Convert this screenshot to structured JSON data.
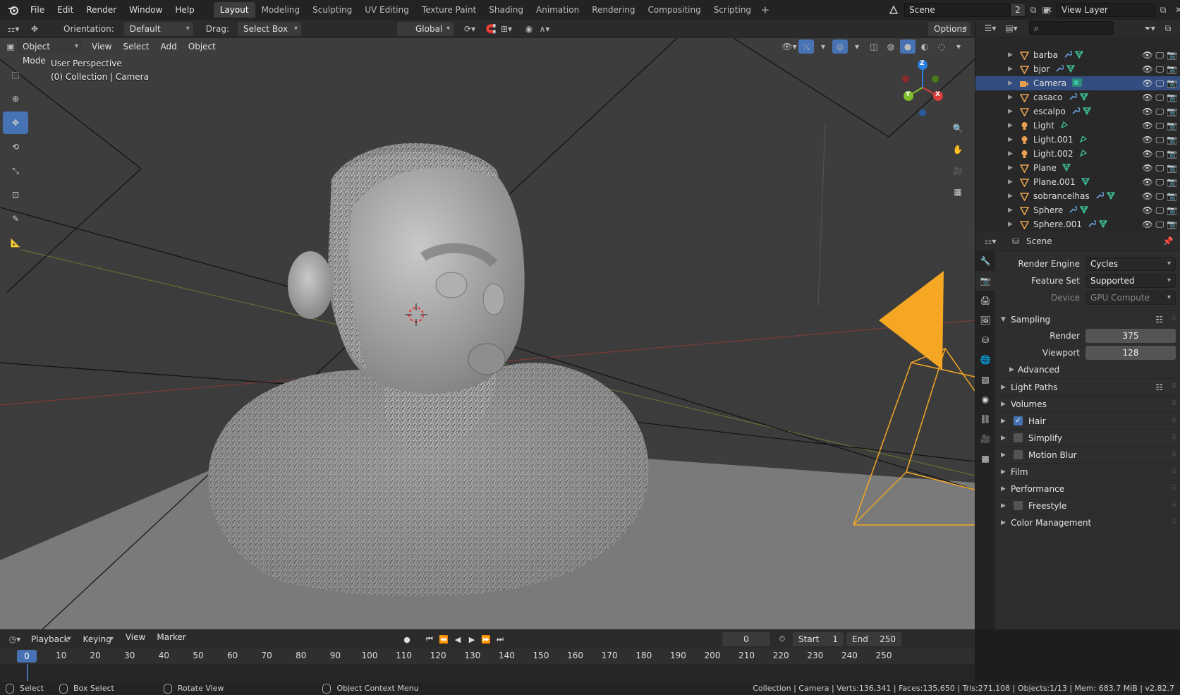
{
  "topbar": {
    "menus": [
      "File",
      "Edit",
      "Render",
      "Window",
      "Help"
    ],
    "workspaces": [
      "Layout",
      "Modeling",
      "Sculpting",
      "UV Editing",
      "Texture Paint",
      "Shading",
      "Animation",
      "Rendering",
      "Compositing",
      "Scripting"
    ],
    "active_workspace": "Layout",
    "scene_name": "Scene",
    "scene_users": "2",
    "view_layer": "View Layer"
  },
  "viewport_header": {
    "orientation_label": "Orientation:",
    "orientation_value": "Default",
    "drag_label": "Drag:",
    "drag_value": "Select Box",
    "transform_orientation": "Global",
    "options_label": "Options"
  },
  "viewport_menu": {
    "mode": "Object Mode",
    "items": [
      "View",
      "Select",
      "Add",
      "Object"
    ]
  },
  "viewport_overlay": {
    "perspective": "User Perspective",
    "collection": "(0) Collection | Camera"
  },
  "gizmo": {
    "x": "X",
    "y": "Y",
    "z": "Z"
  },
  "outliner": {
    "rows": [
      {
        "name": "barba",
        "icon": "mesh-icon",
        "mods": [
          "wrench-icon",
          "mesh-data-icon"
        ],
        "selected": false
      },
      {
        "name": "bjor",
        "icon": "mesh-icon",
        "mods": [
          "wrench-icon",
          "mesh-data-icon"
        ],
        "selected": false
      },
      {
        "name": "Camera",
        "icon": "camera-icon",
        "mods": [
          "camera-data-icon"
        ],
        "selected": true
      },
      {
        "name": "casaco",
        "icon": "mesh-icon",
        "mods": [
          "wrench-icon",
          "mesh-data-icon"
        ],
        "selected": false
      },
      {
        "name": "escalpo",
        "icon": "mesh-icon",
        "mods": [
          "wrench-icon",
          "mesh-data-icon"
        ],
        "selected": false
      },
      {
        "name": "Light",
        "icon": "light-icon",
        "mods": [
          "light-data-icon"
        ],
        "selected": false
      },
      {
        "name": "Light.001",
        "icon": "light-icon",
        "mods": [
          "light-data-icon"
        ],
        "selected": false
      },
      {
        "name": "Light.002",
        "icon": "light-icon",
        "mods": [
          "light-data-icon"
        ],
        "selected": false
      },
      {
        "name": "Plane",
        "icon": "mesh-icon",
        "mods": [
          "mesh-data-icon"
        ],
        "selected": false
      },
      {
        "name": "Plane.001",
        "icon": "mesh-icon",
        "mods": [
          "mesh-data-icon"
        ],
        "selected": false
      },
      {
        "name": "sobrancelhas",
        "icon": "mesh-icon",
        "mods": [
          "wrench-icon",
          "mesh-data-icon"
        ],
        "selected": false
      },
      {
        "name": "Sphere",
        "icon": "mesh-icon",
        "mods": [
          "wrench-icon",
          "mesh-data-icon"
        ],
        "selected": false
      },
      {
        "name": "Sphere.001",
        "icon": "mesh-icon",
        "mods": [
          "wrench-icon",
          "mesh-data-icon"
        ],
        "selected": false
      }
    ]
  },
  "properties": {
    "context": "Scene",
    "render_engine_label": "Render Engine",
    "render_engine": "Cycles",
    "feature_set_label": "Feature Set",
    "feature_set": "Supported",
    "device_label": "Device",
    "device": "GPU Compute",
    "sampling": {
      "title": "Sampling",
      "render_label": "Render",
      "render": "375",
      "viewport_label": "Viewport",
      "viewport": "128",
      "advanced": "Advanced"
    },
    "panels": [
      {
        "label": "Light Paths",
        "checkbox": null,
        "list": true
      },
      {
        "label": "Volumes",
        "checkbox": null,
        "list": false
      },
      {
        "label": "Hair",
        "checkbox": true,
        "list": false
      },
      {
        "label": "Simplify",
        "checkbox": false,
        "list": false
      },
      {
        "label": "Motion Blur",
        "checkbox": false,
        "list": false
      },
      {
        "label": "Film",
        "checkbox": null,
        "list": false
      },
      {
        "label": "Performance",
        "checkbox": null,
        "list": false
      },
      {
        "label": "Freestyle",
        "checkbox": false,
        "list": false
      },
      {
        "label": "Color Management",
        "checkbox": null,
        "list": false
      }
    ]
  },
  "timeline": {
    "menus": [
      "Playback",
      "Keying",
      "View",
      "Marker"
    ],
    "current_frame": "0",
    "start_label": "Start",
    "start": "1",
    "end_label": "End",
    "end": "250",
    "ticks": [
      "0",
      "10",
      "20",
      "30",
      "40",
      "50",
      "60",
      "70",
      "80",
      "90",
      "100",
      "110",
      "120",
      "130",
      "140",
      "150",
      "160",
      "170",
      "180",
      "190",
      "200",
      "210",
      "220",
      "230",
      "240",
      "250"
    ]
  },
  "statusbar": {
    "select": "Select",
    "box_select": "Box Select",
    "rotate_view": "Rotate View",
    "context_menu": "Object Context Menu",
    "stats": "Collection | Camera | Verts:136,341 | Faces:135,650 | Tris:271,108 | Objects:1/13 | Mem: 683.7 MiB | v2.82.7"
  },
  "colors": {
    "accent": "#4772b3",
    "camera": "#f5a623",
    "selection": "#334d80",
    "mesh": "#e8a050",
    "data": "#3ec6a0"
  }
}
